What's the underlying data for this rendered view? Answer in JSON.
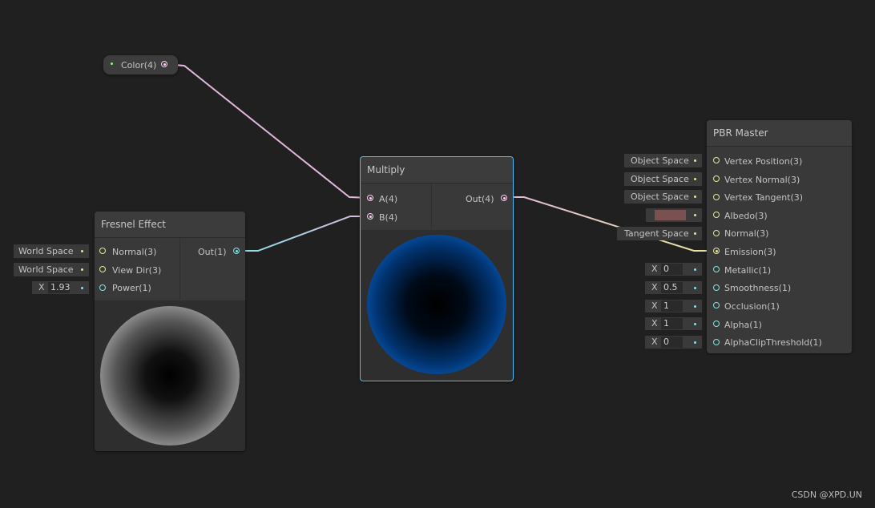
{
  "graph": {
    "color_node": {
      "label": "Color(4)"
    },
    "fresnel": {
      "title": "Fresnel Effect",
      "inputs": [
        "Normal(3)",
        "View Dir(3)",
        "Power(1)"
      ],
      "output": "Out(1)",
      "normal_space": "World Space",
      "viewdir_space": "World Space",
      "power_label": "X",
      "power_value": "1.93"
    },
    "multiply": {
      "title": "Multiply",
      "inputs": [
        "A(4)",
        "B(4)"
      ],
      "output": "Out(4)"
    },
    "pbr": {
      "title": "PBR Master",
      "slots": [
        "Vertex Position(3)",
        "Vertex Normal(3)",
        "Vertex Tangent(3)",
        "Albedo(3)",
        "Normal(3)",
        "Emission(3)",
        "Metallic(1)",
        "Smoothness(1)",
        "Occlusion(1)",
        "Alpha(1)",
        "AlphaClipThreshold(1)"
      ],
      "vertex_position_space": "Object Space",
      "vertex_normal_space": "Object Space",
      "vertex_tangent_space": "Object Space",
      "albedo_color": "#7b5050",
      "normal_space": "Tangent Space",
      "x_label": "X",
      "metallic": "0",
      "smoothness": "0.5",
      "occlusion": "1",
      "alpha": "1",
      "alpha_clip": "0"
    }
  },
  "colors": {
    "background": "#202020",
    "vec3_port": "#e6e69a",
    "vec1_port": "#84e4e7",
    "vec4_port": "#fbcbf4",
    "vec2_port": "#9aef92",
    "selection": "#44c0ff"
  },
  "watermark": "CSDN @XPD.UN"
}
